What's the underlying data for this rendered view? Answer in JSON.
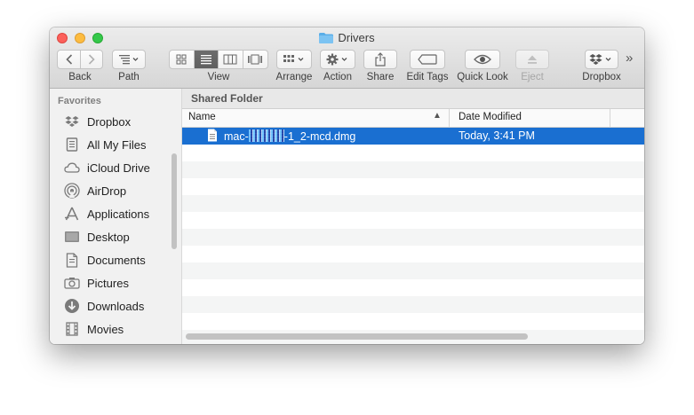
{
  "window": {
    "title": "Drivers"
  },
  "toolbar": {
    "back_label": "Back",
    "path_label": "Path",
    "view_label": "View",
    "arrange_label": "Arrange",
    "action_label": "Action",
    "share_label": "Share",
    "edit_tags_label": "Edit Tags",
    "quick_look_label": "Quick Look",
    "eject_label": "Eject",
    "dropbox_label": "Dropbox",
    "overflow": "»"
  },
  "sidebar": {
    "heading": "Favorites",
    "items": [
      {
        "label": "Dropbox",
        "icon": "dropbox-icon"
      },
      {
        "label": "All My Files",
        "icon": "all-files-icon"
      },
      {
        "label": "iCloud Drive",
        "icon": "cloud-icon"
      },
      {
        "label": "AirDrop",
        "icon": "airdrop-icon"
      },
      {
        "label": "Applications",
        "icon": "applications-icon"
      },
      {
        "label": "Desktop",
        "icon": "desktop-icon"
      },
      {
        "label": "Documents",
        "icon": "documents-icon"
      },
      {
        "label": "Pictures",
        "icon": "camera-icon"
      },
      {
        "label": "Downloads",
        "icon": "download-icon"
      },
      {
        "label": "Movies",
        "icon": "film-icon"
      }
    ]
  },
  "content": {
    "path_header": "Shared Folder",
    "columns": {
      "name": "Name",
      "date_modified": "Date Modified"
    },
    "files": [
      {
        "name_prefix": "mac-",
        "name_suffix": "-1_2-mcd.dmg",
        "date": "Today, 3:41 PM",
        "selected": true
      }
    ]
  },
  "colors": {
    "selection": "#1a6fd1",
    "close": "#fc605b",
    "minimize": "#fdbc40",
    "maximize": "#34c84a",
    "folder": "#5aaee8"
  }
}
